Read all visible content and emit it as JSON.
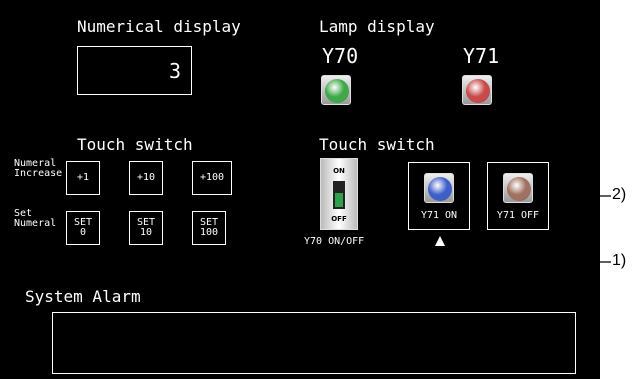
{
  "numerical": {
    "title": "Numerical display",
    "value": "3"
  },
  "lamp": {
    "title": "Lamp display",
    "y70": {
      "label": "Y70",
      "color": "#3fa84a"
    },
    "y71": {
      "label": "Y71",
      "color": "#c84a4a"
    }
  },
  "touch_left": {
    "title": "Touch switch",
    "row1_label": "Numeral\nIncrease",
    "row2_label": "Set\nNumeral",
    "increase": [
      "+1",
      "+10",
      "+100"
    ],
    "set": [
      "SET\n0",
      "SET\n10",
      "SET\n100"
    ]
  },
  "touch_right": {
    "title": "Touch switch",
    "toggle_on": "ON",
    "toggle_off": "OFF",
    "toggle_label": "Y70 ON/OFF",
    "y71_on": "Y71 ON",
    "y71_off": "Y71 OFF",
    "y71_on_color": "#3f5fc8",
    "y71_off_color": "#a07060"
  },
  "alarm": {
    "title": "System Alarm"
  },
  "annotations": {
    "one": "1)",
    "two": "2)"
  }
}
